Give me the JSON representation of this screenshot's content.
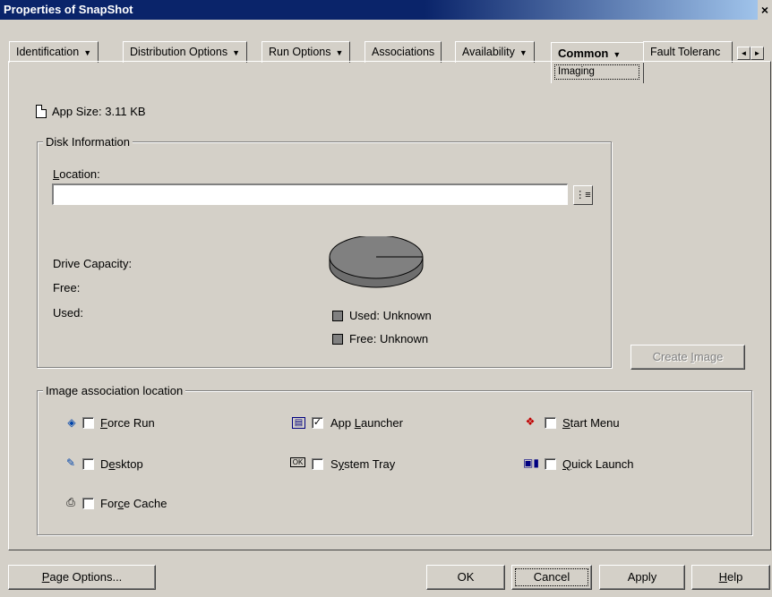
{
  "window": {
    "title": "Properties of SnapShot",
    "close_label": "×"
  },
  "tabs": [
    {
      "label": "Identification",
      "dropdown": true
    },
    {
      "label": "Distribution Options",
      "dropdown": true
    },
    {
      "label": "Run Options",
      "dropdown": true
    },
    {
      "label": "Associations",
      "dropdown": false
    },
    {
      "label": "Availability",
      "dropdown": true
    },
    {
      "label": "Common",
      "dropdown": true,
      "active": true,
      "subtab": "Imaging"
    },
    {
      "label": "Fault Toleranc",
      "dropdown": false
    }
  ],
  "tab_scroll": {
    "left": "◄",
    "right": "►"
  },
  "app_size": "App Size: 3.11 KB",
  "disk_info": {
    "group_title": "Disk Information",
    "location_label": "Location:",
    "location_value": "",
    "drive_capacity_label": "Drive Capacity:",
    "free_label": "Free:",
    "used_label": "Used:",
    "legend_used": "Used: Unknown",
    "legend_free": "Free: Unknown",
    "create_image_label": "Create Image"
  },
  "association": {
    "group_title": "Image association location",
    "options": [
      {
        "label": "Force Run",
        "checked": false,
        "icon": "force-run-icon"
      },
      {
        "label": "App Launcher",
        "checked": true,
        "icon": "app-launcher-icon"
      },
      {
        "label": "Start Menu",
        "checked": false,
        "icon": "start-menu-icon"
      },
      {
        "label": "Desktop",
        "checked": false,
        "icon": "desktop-icon"
      },
      {
        "label": "System Tray",
        "checked": false,
        "icon": "system-tray-icon"
      },
      {
        "label": "Quick Launch",
        "checked": false,
        "icon": "quick-launch-icon"
      },
      {
        "label": "Force Cache",
        "checked": false,
        "icon": "force-cache-icon"
      }
    ]
  },
  "buttons": {
    "page_options": "Page Options...",
    "ok": "OK",
    "cancel": "Cancel",
    "apply": "Apply",
    "help": "Help"
  }
}
